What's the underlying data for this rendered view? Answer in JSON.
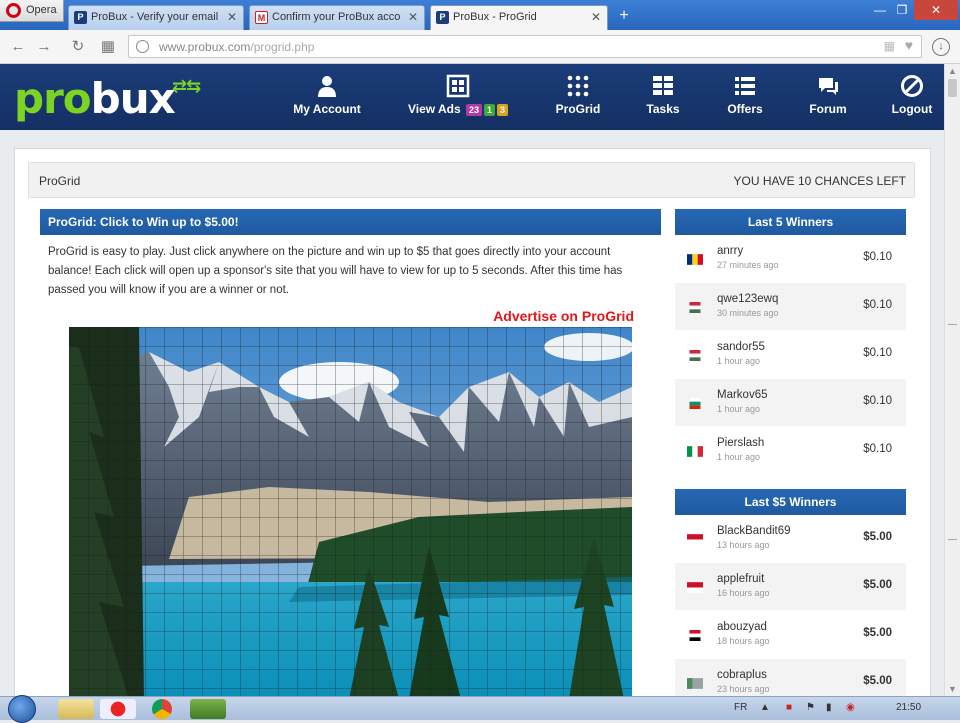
{
  "browser": {
    "menu_label": "Opera",
    "tabs": [
      {
        "label": "ProBux - Verify your email",
        "icon": "probux-favicon"
      },
      {
        "label": "Confirm your ProBux acco",
        "icon": "gmail-favicon"
      },
      {
        "label": "ProBux - ProGrid",
        "icon": "probux-favicon",
        "active": true
      }
    ],
    "url_host": "www.probux.com",
    "url_path": "/progrid.php"
  },
  "site": {
    "logo_text_a": "pro",
    "logo_text_b": "bux",
    "nav": [
      {
        "label": "My Account",
        "icon": "user-icon"
      },
      {
        "label": "View Ads",
        "icon": "ads-icon",
        "badges": [
          "23",
          "1",
          "3"
        ]
      },
      {
        "label": "ProGrid",
        "icon": "grid-icon"
      },
      {
        "label": "Tasks",
        "icon": "tasks-icon"
      },
      {
        "label": "Offers",
        "icon": "offers-icon"
      },
      {
        "label": "Forum",
        "icon": "forum-icon"
      },
      {
        "label": "Logout",
        "icon": "logout-icon"
      }
    ]
  },
  "page": {
    "breadcrumb": "ProGrid",
    "chances_text": "YOU HAVE 10 CHANCES LEFT",
    "main_title": "ProGrid: Click to Win up to $5.00!",
    "intro": "ProGrid is easy to play. Just click anywhere on the picture and win up to $5 that goes directly into your account balance! Each click will open up a sponsor's site that you will have to view for up to 5 seconds. After this time has passed you will know if you are a winner or not.",
    "advertise": "Advertise on ProGrid"
  },
  "last5": {
    "title": "Last 5 Winners",
    "rows": [
      {
        "name": "anrry",
        "time": "27 minutes ago",
        "amount": "$0.10",
        "flag": "ro"
      },
      {
        "name": "qwe123ewq",
        "time": "30 minutes ago",
        "amount": "$0.10",
        "flag": "hu"
      },
      {
        "name": "sandor55",
        "time": "1 hour ago",
        "amount": "$0.10",
        "flag": "hu"
      },
      {
        "name": "Markov65",
        "time": "1 hour ago",
        "amount": "$0.10",
        "flag": "bg"
      },
      {
        "name": "Pierslash",
        "time": "1 hour ago",
        "amount": "$0.10",
        "flag": "it"
      }
    ]
  },
  "last5d": {
    "title": "Last $5 Winners",
    "rows": [
      {
        "name": "BlackBandit69",
        "time": "13 hours ago",
        "amount": "$5.00",
        "flag": "id"
      },
      {
        "name": "applefruit",
        "time": "16 hours ago",
        "amount": "$5.00",
        "flag": "id"
      },
      {
        "name": "abouzyad",
        "time": "18 hours ago",
        "amount": "$5.00",
        "flag": "eg"
      },
      {
        "name": "cobraplus",
        "time": "23 hours ago",
        "amount": "$5.00",
        "flag": "xx"
      }
    ]
  },
  "taskbar": {
    "lang": "FR",
    "clock": "21:50"
  }
}
